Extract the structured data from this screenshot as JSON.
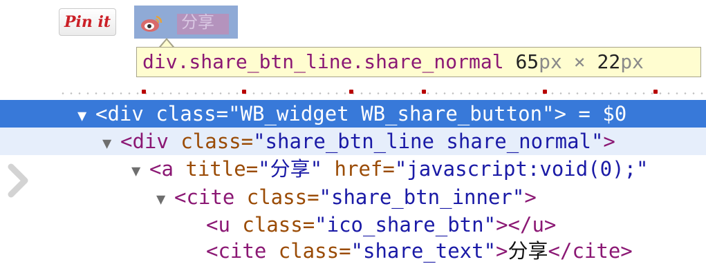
{
  "preview": {
    "pinit_label": "Pin it",
    "share_label": "分享"
  },
  "tooltip": {
    "selector": "div.share_btn_line.share_normal",
    "width_value": "65",
    "width_unit": "px",
    "times": "×",
    "height_value": "22",
    "height_unit": "px"
  },
  "dom_tree": {
    "rows": [
      {
        "triangle": "▼",
        "open": "<div ",
        "attr1_name": "class=",
        "attr1_value": "\"WB_widget WB_share_button\"",
        "close": ">",
        "suffix": " = $0"
      },
      {
        "triangle": "▼",
        "open": "<div ",
        "attr1_name": "class=",
        "attr1_value": "\"share_btn_line share_normal\"",
        "close": ">"
      },
      {
        "triangle": "▼",
        "open": "<a ",
        "attr1_name": "title=",
        "attr1_value": "\"分享\"",
        "attr2_name": " href=",
        "attr2_value": "\"javascript:void(0);\""
      },
      {
        "triangle": "▼",
        "open": "<cite ",
        "attr1_name": "class=",
        "attr1_value": "\"share_btn_inner\"",
        "close": ">"
      },
      {
        "open": "<u ",
        "attr1_name": "class=",
        "attr1_value": "\"ico_share_btn\"",
        "close": "></u>"
      },
      {
        "open": "<cite ",
        "attr1_name": "class=",
        "attr1_value": "\"share_text\"",
        "close": ">",
        "text": "分享",
        "end_tag": "</cite>"
      }
    ]
  },
  "colors": {
    "selected_row": "#3879d9",
    "hover_row": "#e6eefb",
    "tag": "#8b1874",
    "attr_name": "#9a4b05",
    "attr_value": "#1a1aa6",
    "tooltip_bg": "#fffdd0",
    "pinit_red": "#cb2027"
  },
  "icons": [
    "weibo-eye-icon",
    "expand-triangle-icon",
    "chevron-right-icon"
  ]
}
